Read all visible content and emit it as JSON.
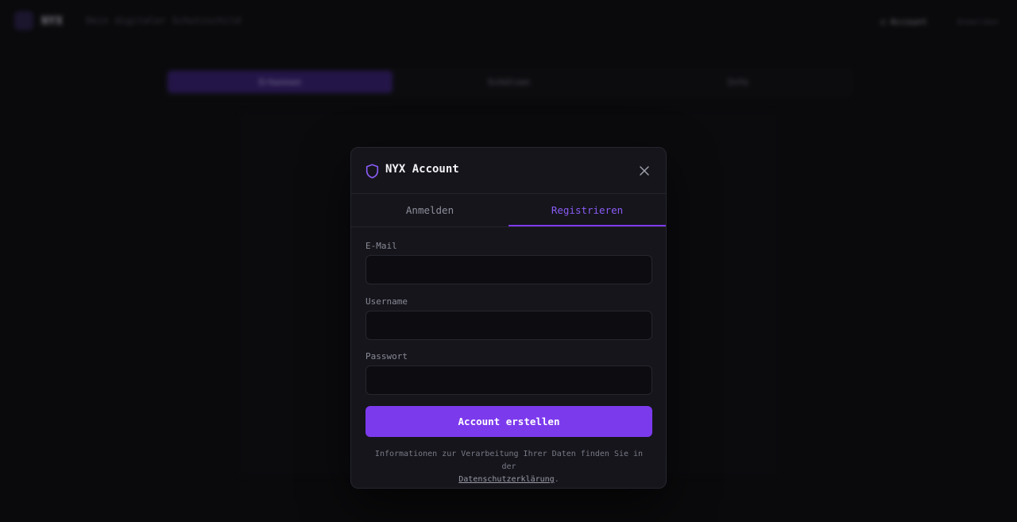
{
  "background": {
    "brand": "NYX",
    "tagline": "Dein digitaler Schutzschild",
    "header_account_label": "Account",
    "header_login_label": "Anmelden",
    "modes": [
      {
        "label": "Erkennen",
        "active": true
      },
      {
        "label": "Schützen",
        "active": false
      },
      {
        "label": "Info",
        "active": false
      }
    ]
  },
  "modal": {
    "title": "NYX Account",
    "icon": "shield-icon",
    "tabs": [
      {
        "label": "Anmelden",
        "active": false
      },
      {
        "label": "Registrieren",
        "active": true
      }
    ],
    "fields": {
      "email": {
        "label": "E-Mail",
        "value": "",
        "placeholder": ""
      },
      "username": {
        "label": "Username",
        "value": "",
        "placeholder": ""
      },
      "password": {
        "label": "Passwort",
        "value": "",
        "placeholder": ""
      }
    },
    "submit_label": "Account erstellen",
    "privacy_text": "Informationen zur Verarbeitung Ihrer Daten finden Sie in der",
    "privacy_link": "Datenschutzerklärung",
    "privacy_suffix": "."
  },
  "colors": {
    "accent": "#7c3aed",
    "accent_text": "#8b5cf6",
    "background": "#0a0a0c",
    "modal_bg": "#15151b"
  }
}
